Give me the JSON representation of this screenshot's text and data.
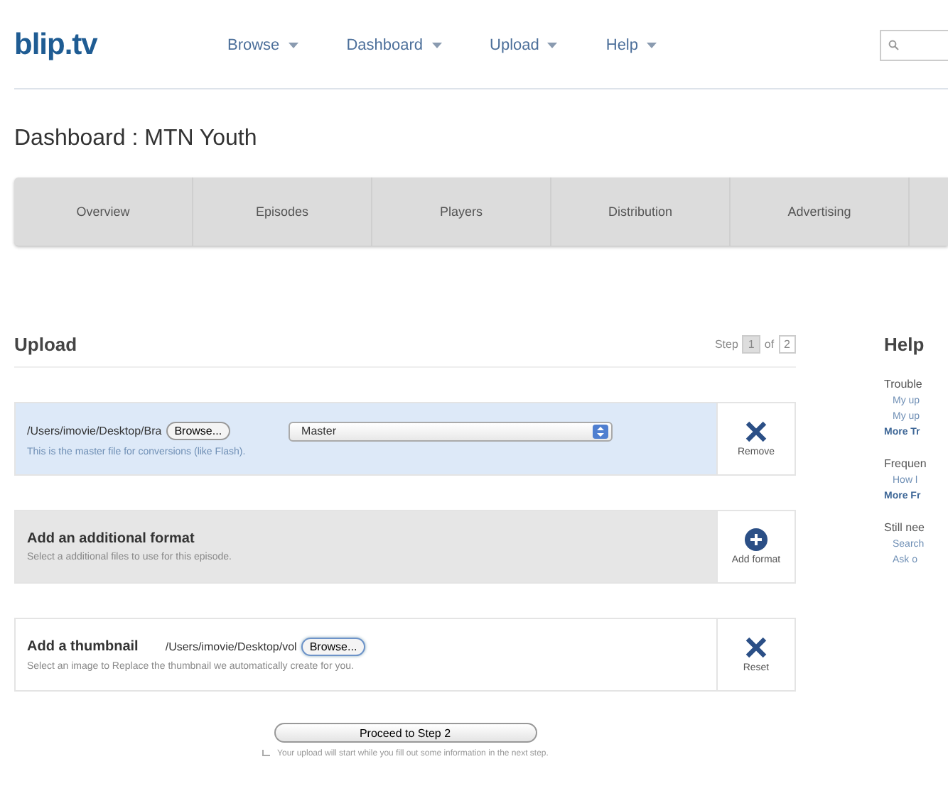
{
  "logo": "blip.tv",
  "nav": [
    {
      "label": "Browse"
    },
    {
      "label": "Dashboard"
    },
    {
      "label": "Upload"
    },
    {
      "label": "Help"
    }
  ],
  "page_title": "Dashboard : MTN Youth",
  "tabs": [
    {
      "label": "Overview",
      "selected": false
    },
    {
      "label": "Episodes",
      "selected": false
    },
    {
      "label": "Players",
      "selected": false
    },
    {
      "label": "Distribution",
      "selected": false
    },
    {
      "label": "Advertising",
      "selected": false
    }
  ],
  "upload": {
    "heading": "Upload",
    "step": {
      "prefix": "Step",
      "current": "1",
      "of": "of",
      "total": "2"
    },
    "panels": [
      {
        "kind": "file",
        "highlighted": true,
        "file_value": "/Users/imovie/Desktop/Bra",
        "browse": "Browse...",
        "select_value": "Master",
        "description": "This is the master file for conversions (like Flash).",
        "action": "Remove"
      },
      {
        "kind": "add",
        "highlighted": false,
        "title": "Add an additional format",
        "description": "Select a additional files to use for this episode.",
        "action": "Add format"
      },
      {
        "kind": "thumb",
        "highlighted": false,
        "title": "Add a thumbnail",
        "file_value": "/Users/imovie/Desktop/vol",
        "browse": "Browse...",
        "description": "Select an image to Replace the thumbnail we automatically create for you.",
        "action": "Reset"
      }
    ],
    "proceed": "Proceed to Step 2",
    "note": "Your upload will start while you fill out some information in the next step."
  },
  "help": {
    "heading": "Help",
    "sections": [
      {
        "title": "Trouble",
        "links": [
          "My up",
          "My up"
        ],
        "more": "More Tr"
      },
      {
        "title": "Frequen",
        "links": [
          "How l"
        ],
        "more": "More Fr"
      },
      {
        "title": "Still nee",
        "links": [
          "Search",
          "Ask o"
        ]
      }
    ]
  }
}
